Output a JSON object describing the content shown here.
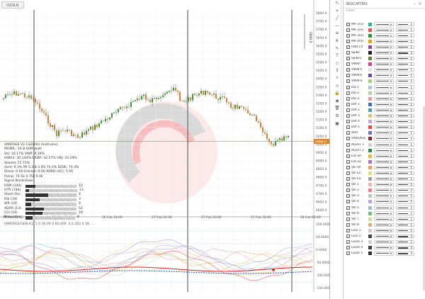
{
  "tab": {
    "symbol": "ISS9LN"
  },
  "info": {
    "lines": [
      "VANTAGE V2     F.S2D(H) (Instrume)",
      "MOMS.: 16.8 SOM  watt",
      "Vol: 10.17%  VWP: 4.16%",
      "HWH2: 30.144%  CADR: 42.57%  HRJ: 33.29%",
      "Volume 72.71%",
      "Sent: 9.3% PR 5.3  8.3  DS 74.3%  SEDE: 70.3%",
      "Share: 0.00  Extract: 0.00  ADRD (AC): 5.05",
      "Pump: 74.5k  0.75k  6.0k",
      "Signal Breakdown"
    ],
    "indicators": [
      {
        "label": "HSM (14d)",
        "bar": 14,
        "hatch": 58,
        "value": "10"
      },
      {
        "label": "HTR (14d)",
        "bar": 5,
        "hatch": 68,
        "value": "13"
      },
      {
        "label": "Stoch Osc",
        "bar": 32,
        "hatch": 40,
        "value": "4"
      },
      {
        "label": "RSI (14)",
        "bar": 20,
        "hatch": 52,
        "value": "3"
      },
      {
        "label": "WR (14)",
        "bar": 8,
        "hatch": 64,
        "value": "4"
      },
      {
        "label": "ADXR (14)",
        "bar": 26,
        "hatch": 46,
        "value": "52"
      },
      {
        "label": "CCI (14)",
        "bar": 24,
        "hatch": 48,
        "value": "19"
      },
      {
        "label": "New price",
        "bar": 10,
        "hatch": 60,
        "value": "8"
      }
    ]
  },
  "subchart": {
    "title": "VANTAGE(GEN.A1) 1.0 30.00   0  60.000 .S.2.202 0 18 ..."
  },
  "price_axis": [
    "5800.0",
    "5750.0",
    "5700.0",
    "5650.0",
    "5600.0",
    "5550.0",
    "5500.0",
    "5450.0",
    "5400.0",
    "5350.0",
    "5300.0",
    "5250.0",
    "5200.0",
    "5150.0",
    "5100.0",
    "5050.0",
    "5000.0",
    "4950.0",
    "4900.0",
    "4850.0",
    "4800.0",
    "4750.0",
    "4700.0",
    "4650.0",
    "4600.0"
  ],
  "current_price": "5088.0",
  "sub_axis": [
    "100.0000",
    "50.0000",
    "0.0000",
    "-50.0000",
    "-100.0000",
    "-150.0000"
  ],
  "time_axis": [
    "26 Feb 02:00",
    "26 Feb 10:00",
    "26 Feb 18:00",
    "27 Feb 02:00",
    "27 Feb 10:00",
    "27 Feb 18:00",
    "28 Feb 02:00"
  ],
  "toolbar_icons": [
    "cursor-icon",
    "crosshair-icon",
    "trend-line-icon",
    "horizontal-line-icon",
    "fib-icon",
    "pitchfork-icon",
    "brush-icon",
    "text-icon",
    "pattern-icon",
    "measure-icon",
    "zoom-icon",
    "magnet-icon",
    "lock-icon",
    "eye-icon",
    "trash-icon",
    "settings-icon",
    "camera-icon"
  ],
  "toolbar_glyphs": [
    "↖",
    "+",
    "╱",
    "—",
    "≡",
    "⋔",
    "✎",
    "T",
    "◇",
    "↕",
    "⌕",
    "∩",
    "🔒",
    "◉",
    "🗑",
    "⚙",
    "▣"
  ],
  "settings": {
    "title": "INDICATORS",
    "subtitle": "Lines",
    "rows": [
      {
        "name": "MA 1(S)",
        "color": "#2bb3a3",
        "thick": 1
      },
      {
        "name": "MA 2(S)",
        "color": "#e05555",
        "thick": 1
      },
      {
        "name": "MA 3(S)",
        "color": "#2f8f3f",
        "thick": 1
      },
      {
        "name": "MA 4(S)",
        "color": "#e8a020",
        "thick": 1
      },
      {
        "name": "Odd Ch",
        "color": "#8b4c9e",
        "thick": 1
      },
      {
        "name": "Spike",
        "color": "#1c1c1c",
        "thick": 3
      },
      {
        "name": "Spike1",
        "color": "#6d7a3c",
        "thick": 1
      },
      {
        "name": "VWAP",
        "color": "#c24a8c",
        "thick": 1
      },
      {
        "name": "VWAP1",
        "color": "#e0e0e0",
        "thick": 1
      },
      {
        "name": "VWAP2",
        "color": "#6a4ab0",
        "thick": 1
      },
      {
        "name": "VWAP3",
        "color": "#9ed07c",
        "thick": 1
      },
      {
        "name": "DD 1",
        "color": "#a5c4e8",
        "thick": 1
      },
      {
        "name": "DD 2",
        "color": "#b8cf9c",
        "thick": 1
      },
      {
        "name": "DD 3",
        "color": "#e89aa0",
        "thick": 1
      },
      {
        "name": "Def 1",
        "color": "#3b6fb8",
        "thick": 1
      },
      {
        "name": "Def 2",
        "color": "#40a0b0",
        "thick": 1
      },
      {
        "name": "Def 3",
        "color": "#e0c070",
        "thick": 1
      },
      {
        "name": "Def 4",
        "color": "#c8a0d8",
        "thick": 1
      },
      {
        "name": "Def 5",
        "color": "#e84a4a",
        "thick": 1
      },
      {
        "name": "ADX",
        "color": "#7070d0",
        "thick": 1
      },
      {
        "name": "VANTAGE",
        "color": "#8a2a2a",
        "thick": 1
      },
      {
        "name": "ALERT 1",
        "color": "#d0d0d0",
        "thick": 1
      },
      {
        "name": "ALERT 2",
        "color": "#2a8a4a",
        "thick": 1
      },
      {
        "name": "Ext Sh",
        "color": "#d8c038",
        "thick": 1
      },
      {
        "name": "Ext Lo",
        "color": "#b070c0",
        "thick": 1
      },
      {
        "name": "Vol Sh",
        "color": "#f0a060",
        "thick": 1
      },
      {
        "name": "Vol Lo",
        "color": "#e0e070",
        "thick": 1
      },
      {
        "name": "Vol Ex",
        "color": "#a0a0a0",
        "thick": 1
      },
      {
        "name": "Vol 1",
        "color": "#e8b8b8",
        "thick": 1
      },
      {
        "name": "Vol 2",
        "color": "#f08080",
        "thick": 2
      },
      {
        "name": "Vol 3",
        "color": "#b0d0b0",
        "thick": 1
      },
      {
        "name": "Vol 4",
        "color": "#c0a0e0",
        "thick": 1
      },
      {
        "name": "Vol 5",
        "color": "#9cbcd4",
        "thick": 1
      },
      {
        "name": "Vol 6",
        "color": "#70c070",
        "thick": 1
      },
      {
        "name": "Vol 7",
        "color": "#d8d8a0",
        "thick": 1
      },
      {
        "name": "Vol 8",
        "color": "#e0b070",
        "thick": 1
      },
      {
        "name": "Clos 1",
        "color": "#f0c0d0",
        "thick": 1
      },
      {
        "name": "Clos 2",
        "color": "#444444",
        "thick": 3
      },
      {
        "name": "Close 3",
        "color": "#d0d0d0",
        "thick": 1
      },
      {
        "name": "Close 4",
        "color": "#404040",
        "thick": 3
      },
      {
        "name": "Close 5",
        "color": "#303030",
        "thick": 3
      }
    ]
  }
}
